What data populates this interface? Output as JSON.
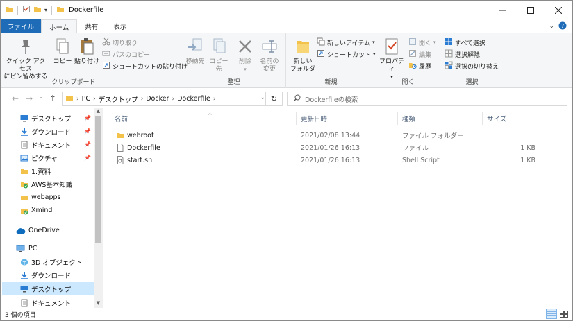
{
  "window": {
    "title": "Dockerfile"
  },
  "tabs": [
    {
      "label": "ファイル"
    },
    {
      "label": "ホーム"
    },
    {
      "label": "共有"
    },
    {
      "label": "表示"
    }
  ],
  "ribbon": {
    "clipboard": {
      "label": "クリップボード",
      "quick_access_line1": "クイック アクセス",
      "quick_access_line2": "にピン留めする",
      "copy": "コピー",
      "paste": "貼り付け",
      "cut": "切り取り",
      "copy_path": "パスのコピー",
      "paste_shortcut": "ショートカットの貼り付け"
    },
    "organize": {
      "label": "整理",
      "move_to": "移動先",
      "copy_to": "コピー先",
      "delete": "削除",
      "rename_line1": "名前の",
      "rename_line2": "変更"
    },
    "new": {
      "label": "新規",
      "new_folder_line1": "新しい",
      "new_folder_line2": "フォルダー",
      "new_item": "新しいアイテム",
      "shortcut": "ショートカット"
    },
    "open": {
      "label": "開く",
      "properties": "プロパティ",
      "open": "開く",
      "edit": "編集",
      "history": "履歴"
    },
    "select": {
      "label": "選択",
      "select_all": "すべて選択",
      "select_none": "選択解除",
      "invert": "選択の切り替え"
    }
  },
  "address": {
    "crumbs": [
      "PC",
      "デスクトップ",
      "Docker",
      "Dockerfile"
    ],
    "search_placeholder": "Dockerfileの検索"
  },
  "nav": {
    "items": [
      {
        "label": "デスクトップ",
        "icon": "desktop-icon",
        "pinned": true
      },
      {
        "label": "ダウンロード",
        "icon": "download-icon",
        "pinned": true
      },
      {
        "label": "ドキュメント",
        "icon": "document-icon",
        "pinned": true
      },
      {
        "label": "ピクチャ",
        "icon": "picture-icon",
        "pinned": true
      },
      {
        "label": "1.資料",
        "icon": "folder-icon",
        "pinned": false
      },
      {
        "label": "AWS基本知識",
        "icon": "folder-sync-icon",
        "pinned": false
      },
      {
        "label": "webapps",
        "icon": "folder-icon",
        "pinned": false
      },
      {
        "label": "Xmind",
        "icon": "folder-sync-icon",
        "pinned": false
      },
      {
        "label": "OneDrive",
        "icon": "onedrive-icon",
        "pinned": false
      },
      {
        "label": "PC",
        "icon": "pc-icon",
        "pinned": false
      },
      {
        "label": "3D オブジェクト",
        "icon": "3d-objects-icon",
        "pinned": false
      },
      {
        "label": "ダウンロード",
        "icon": "download-icon",
        "pinned": false
      },
      {
        "label": "デスクトップ",
        "icon": "desktop-icon",
        "pinned": false
      },
      {
        "label": "ドキュメント",
        "icon": "document-icon",
        "pinned": false
      }
    ]
  },
  "columns": {
    "name": "名前",
    "date": "更新日時",
    "type": "種類",
    "size": "サイズ"
  },
  "files": [
    {
      "name": "webroot",
      "date": "2021/02/08 13:44",
      "type": "ファイル フォルダー",
      "size": "",
      "icon": "folder-icon"
    },
    {
      "name": "Dockerfile",
      "date": "2021/01/26 16:13",
      "type": "ファイル",
      "size": "1 KB",
      "icon": "file-icon"
    },
    {
      "name": "start.sh",
      "date": "2021/01/26 16:13",
      "type": "Shell Script",
      "size": "1 KB",
      "icon": "script-icon"
    }
  ],
  "status": {
    "count": "3 個の項目"
  },
  "colors": {
    "accent": "#1e6bb8",
    "selection": "#cce8ff",
    "folder": "#f3c24a",
    "icon_blue": "#2b7cd3"
  }
}
